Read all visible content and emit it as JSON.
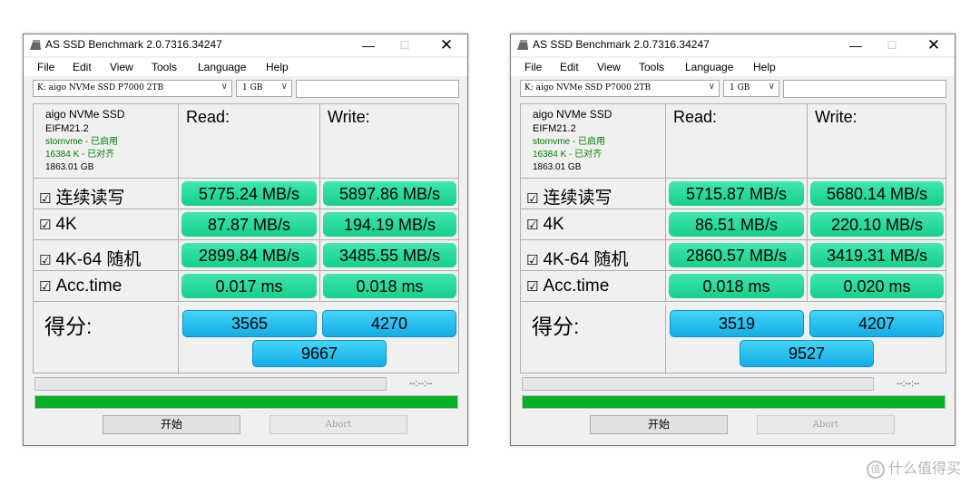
{
  "windows": [
    {
      "title": "AS SSD Benchmark 2.0.7316.34247",
      "controls": {
        "minimize": "—",
        "maximize": "☐",
        "close": "✕"
      },
      "menu": [
        "File",
        "Edit",
        "View",
        "Tools",
        "Language",
        "Help"
      ],
      "drive_select": "K: aigo NVMe SSD P7000 2TB",
      "size_select": "1 GB",
      "info": [
        "aigo NVMe SSD",
        "EIFM21.2",
        "stornvme - 已启用",
        "16384 K - 已对齐",
        "1863.01 GB"
      ],
      "read_header": "Read:",
      "write_header": "Write:",
      "rows": [
        {
          "check": "☑",
          "label": "连续读写",
          "read": "5775.24 MB/s",
          "write": "5897.86 MB/s"
        },
        {
          "check": "☑",
          "label": "4K",
          "read": "87.87 MB/s",
          "write": "194.19 MB/s"
        },
        {
          "check": "☑",
          "label": "4K-64 随机",
          "read": "2899.84 MB/s",
          "write": "3485.55 MB/s"
        },
        {
          "check": "☑",
          "label": "Acc.time",
          "read": "0.017 ms",
          "write": "0.018 ms"
        }
      ],
      "score_label": "得分:",
      "score_read": "3565",
      "score_write": "4270",
      "score_total": "9667",
      "timer": "--:--:--",
      "progress": 1.0,
      "start_button": "开始",
      "abort_button": "Abort"
    },
    {
      "title": "AS SSD Benchmark 2.0.7316.34247",
      "controls": {
        "minimize": "—",
        "maximize": "☐",
        "close": "✕"
      },
      "menu": [
        "File",
        "Edit",
        "View",
        "Tools",
        "Language",
        "Help"
      ],
      "drive_select": "K: aigo NVMe SSD P7000 2TB",
      "size_select": "1 GB",
      "info": [
        "aigo NVMe SSD",
        "EIFM21.2",
        "stornvme - 已启用",
        "16384 K - 已对齐",
        "1863.01 GB"
      ],
      "read_header": "Read:",
      "write_header": "Write:",
      "rows": [
        {
          "check": "☑",
          "label": "连续读写",
          "read": "5715.87 MB/s",
          "write": "5680.14 MB/s"
        },
        {
          "check": "☑",
          "label": "4K",
          "read": "86.51 MB/s",
          "write": "220.10 MB/s"
        },
        {
          "check": "☑",
          "label": "4K-64 随机",
          "read": "2860.57 MB/s",
          "write": "3419.31 MB/s"
        },
        {
          "check": "☑",
          "label": "Acc.time",
          "read": "0.018 ms",
          "write": "0.020 ms"
        }
      ],
      "score_label": "得分:",
      "score_read": "3519",
      "score_write": "4207",
      "score_total": "9527",
      "timer": "--:--:--",
      "progress": 1.0,
      "start_button": "开始",
      "abort_button": "Abort"
    }
  ],
  "watermark": {
    "icon": "值",
    "text": "什么值得买"
  }
}
